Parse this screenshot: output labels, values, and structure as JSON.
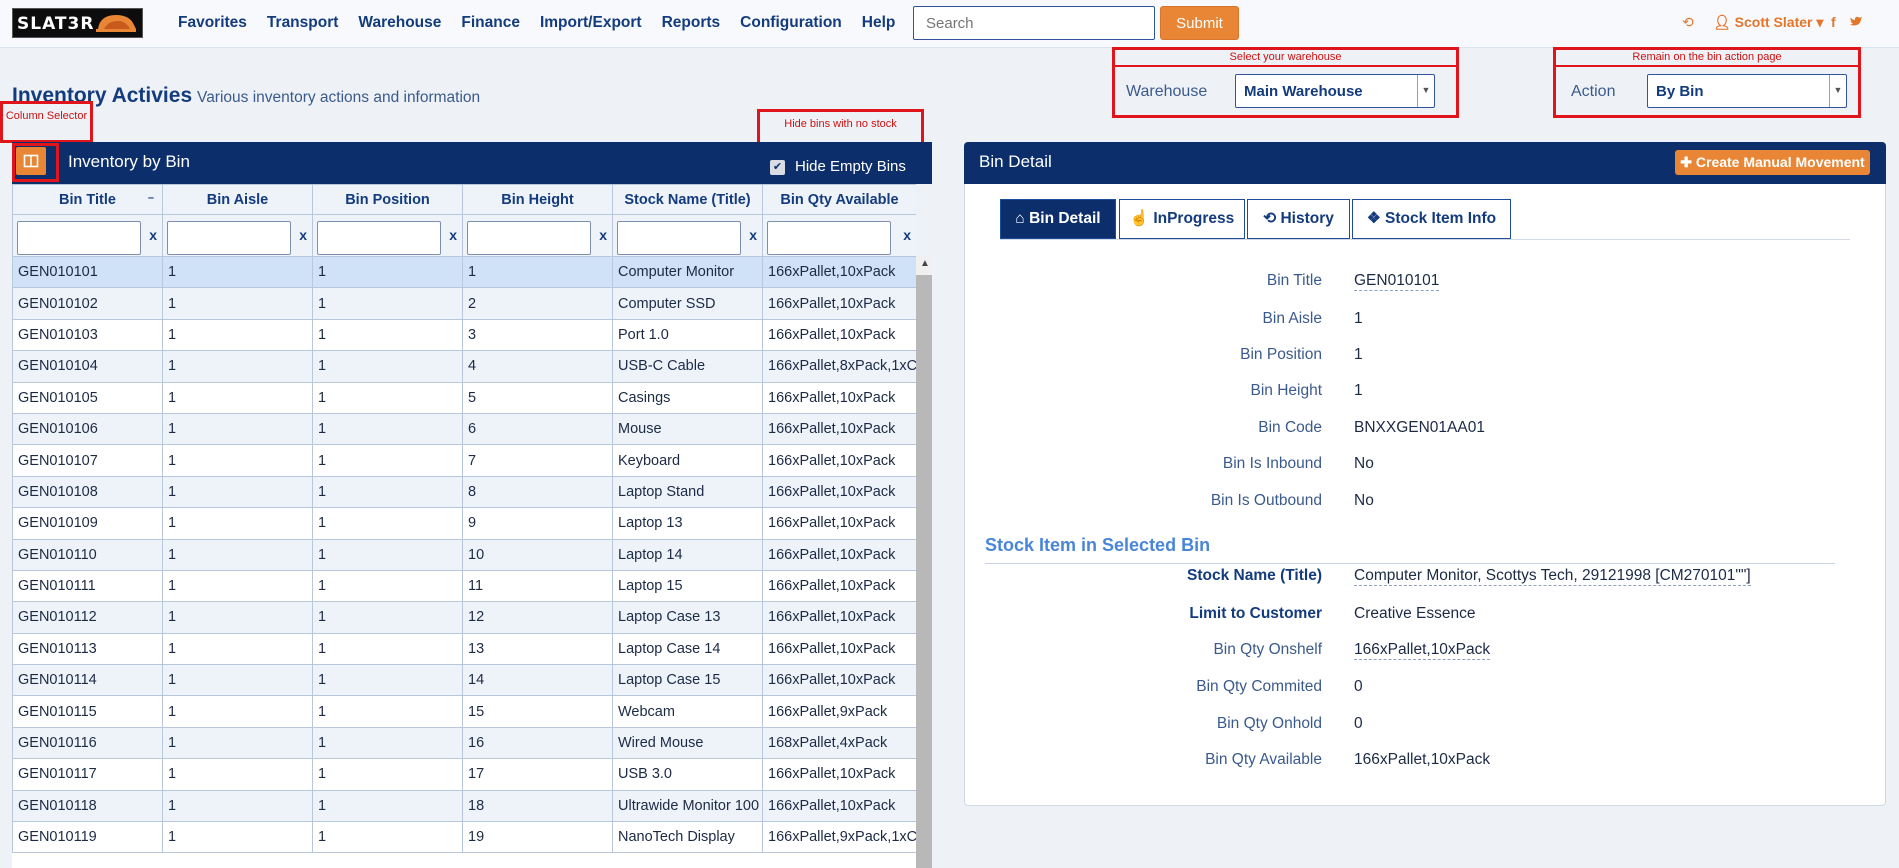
{
  "app": {
    "logo_text": "SLAT3R"
  },
  "nav": {
    "links": [
      "Favorites",
      "Transport",
      "Warehouse",
      "Finance",
      "Import/Export",
      "Reports",
      "Configuration",
      "Help"
    ],
    "search_placeholder": "Search",
    "submit_label": "Submit",
    "user_name": "Scott Slater"
  },
  "header": {
    "title": "Inventory Activies",
    "subtitle": "Various inventory actions and information"
  },
  "annotations": {
    "column_selector": "Column Selector",
    "hide_bins": "Hide bins with no stock",
    "select_warehouse": "Select your warehouse",
    "remain_bin": "Remain on the bin action page"
  },
  "selectors": {
    "warehouse_label": "Warehouse",
    "warehouse_value": "Main Warehouse",
    "action_label": "Action",
    "action_value": "By Bin"
  },
  "left_panel": {
    "title": "Inventory by Bin",
    "hide_empty_label": "Hide Empty Bins",
    "hide_empty_checked": true,
    "columns": [
      "Bin Title",
      "Bin Aisle",
      "Bin Position",
      "Bin Height",
      "Stock Name (Title)",
      "Bin Qty Available"
    ],
    "filter_clear": "x",
    "rows": [
      [
        "GEN010101",
        "1",
        "1",
        "1",
        "Computer Monitor",
        "166xPallet,10xPack"
      ],
      [
        "GEN010102",
        "1",
        "1",
        "2",
        "Computer SSD",
        "166xPallet,10xPack"
      ],
      [
        "GEN010103",
        "1",
        "1",
        "3",
        "Port 1.0",
        "166xPallet,10xPack"
      ],
      [
        "GEN010104",
        "1",
        "1",
        "4",
        "USB-C Cable",
        "166xPallet,8xPack,1xC"
      ],
      [
        "GEN010105",
        "1",
        "1",
        "5",
        "Casings",
        "166xPallet,10xPack"
      ],
      [
        "GEN010106",
        "1",
        "1",
        "6",
        "Mouse",
        "166xPallet,10xPack"
      ],
      [
        "GEN010107",
        "1",
        "1",
        "7",
        "Keyboard",
        "166xPallet,10xPack"
      ],
      [
        "GEN010108",
        "1",
        "1",
        "8",
        "Laptop Stand",
        "166xPallet,10xPack"
      ],
      [
        "GEN010109",
        "1",
        "1",
        "9",
        "Laptop 13",
        "166xPallet,10xPack"
      ],
      [
        "GEN010110",
        "1",
        "1",
        "10",
        "Laptop 14",
        "166xPallet,10xPack"
      ],
      [
        "GEN010111",
        "1",
        "1",
        "11",
        "Laptop 15",
        "166xPallet,10xPack"
      ],
      [
        "GEN010112",
        "1",
        "1",
        "12",
        "Laptop Case 13",
        "166xPallet,10xPack"
      ],
      [
        "GEN010113",
        "1",
        "1",
        "13",
        "Laptop Case 14",
        "166xPallet,10xPack"
      ],
      [
        "GEN010114",
        "1",
        "1",
        "14",
        "Laptop Case 15",
        "166xPallet,10xPack"
      ],
      [
        "GEN010115",
        "1",
        "1",
        "15",
        "Webcam",
        "166xPallet,9xPack"
      ],
      [
        "GEN010116",
        "1",
        "1",
        "16",
        "Wired Mouse",
        "168xPallet,4xPack"
      ],
      [
        "GEN010117",
        "1",
        "1",
        "17",
        "USB 3.0",
        "166xPallet,10xPack"
      ],
      [
        "GEN010118",
        "1",
        "1",
        "18",
        "Ultrawide Monitor 100",
        "166xPallet,10xPack"
      ],
      [
        "GEN010119",
        "1",
        "1",
        "19",
        "NanoTech Display",
        "166xPallet,9xPack,1xC"
      ]
    ]
  },
  "right_panel": {
    "title": "Bin Detail",
    "create_button": "Create Manual Movement",
    "tabs": [
      "Bin Detail",
      "InProgress",
      "History",
      "Stock Item Info"
    ],
    "details": [
      {
        "label": "Bin Title",
        "value": "GEN010101"
      },
      {
        "label": "Bin Aisle",
        "value": "1"
      },
      {
        "label": "Bin Position",
        "value": "1"
      },
      {
        "label": "Bin Height",
        "value": "1"
      },
      {
        "label": "Bin Code",
        "value": "BNXXGEN01AA01"
      },
      {
        "label": "Bin Is Inbound",
        "value": "No"
      },
      {
        "label": "Bin Is Outbound",
        "value": "No"
      }
    ],
    "stock_section_title": "Stock Item in Selected Bin",
    "stock_details": [
      {
        "label": "Stock Name (Title)",
        "value": "Computer Monitor, Scottys Tech, 29121998 [CM270101\"\"]"
      },
      {
        "label": "Limit to Customer",
        "value": "Creative Essence"
      },
      {
        "label": "Bin Qty Onshelf",
        "value": "166xPallet,10xPack"
      },
      {
        "label": "Bin Qty Commited",
        "value": "0"
      },
      {
        "label": "Bin Qty Onhold",
        "value": "0"
      },
      {
        "label": "Bin Qty Available",
        "value": "166xPallet,10xPack"
      }
    ]
  },
  "colors": {
    "navy": "#0c2f6b",
    "orange": "#e88636",
    "annotation_red": "#e0141b"
  }
}
